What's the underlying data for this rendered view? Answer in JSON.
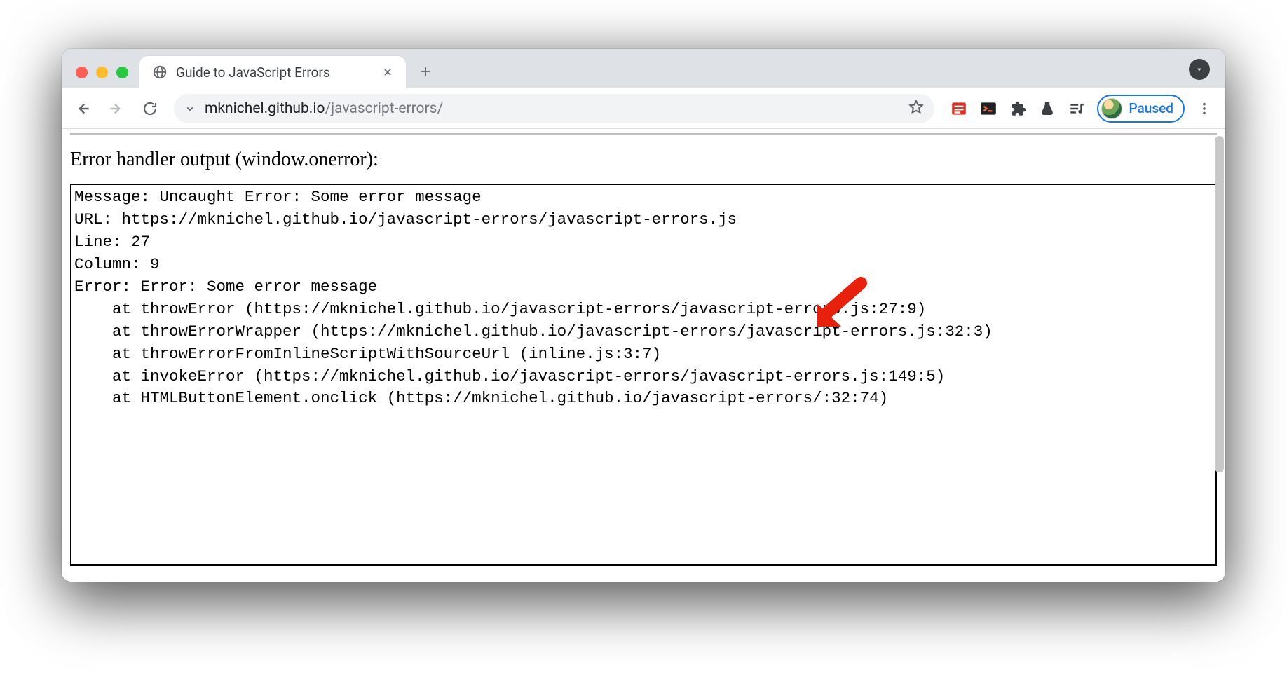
{
  "browser": {
    "tab_title": "Guide to JavaScript Errors",
    "url_host": "mknichel.github.io",
    "url_path": "/javascript-errors/",
    "profile_label": "Paused"
  },
  "page": {
    "section_title": "Error handler output (window.onerror):",
    "output_lines": [
      "Message: Uncaught Error: Some error message",
      "URL: https://mknichel.github.io/javascript-errors/javascript-errors.js",
      "Line: 27",
      "Column: 9",
      "Error: Error: Some error message",
      "    at throwError (https://mknichel.github.io/javascript-errors/javascript-errors.js:27:9)",
      "    at throwErrorWrapper (https://mknichel.github.io/javascript-errors/javascript-errors.js:32:3)",
      "    at throwErrorFromInlineScriptWithSourceUrl (inline.js:3:7)",
      "    at invokeError (https://mknichel.github.io/javascript-errors/javascript-errors.js:149:5)",
      "    at HTMLButtonElement.onclick (https://mknichel.github.io/javascript-errors/:32:74)"
    ]
  }
}
